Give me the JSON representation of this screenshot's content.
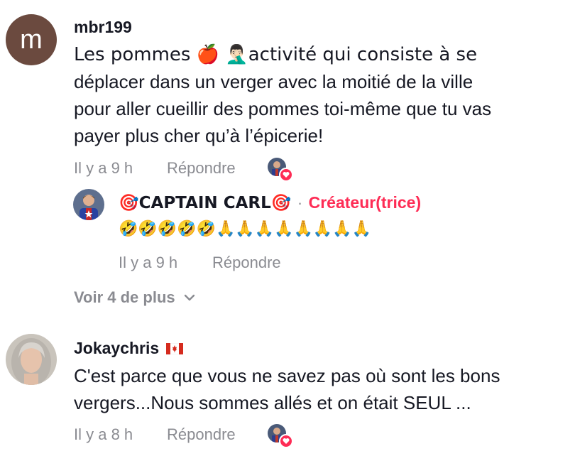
{
  "comments": [
    {
      "avatar_letter": "m",
      "username": "mbr199",
      "text_line1": "Les pommes 🍎 🤦🏻‍♂️activité qui consiste à se",
      "text_line2": "déplacer dans un verger avec la moitié de la ville",
      "text_line3": "pour aller cueillir des pommes toi-même que tu vas",
      "text_line4": "payer plus cher qu’à l’épicerie!",
      "time": "Il y a 9 h",
      "reply_label": "Répondre"
    },
    {
      "username": "Jokaychris",
      "flag": "🇨🇦",
      "text_line1": "C'est parce que vous ne savez pas où sont les bons",
      "text_line2": "vergers...Nous sommes allés et on était SEUL ...",
      "time": "Il y a 8 h",
      "reply_label": "Répondre"
    }
  ],
  "reply": {
    "username": "🎯CAPTAIN CARL🎯",
    "separator": "·",
    "creator_label": "Créateur(trice)",
    "text": "🤣🤣🤣🤣🤣🙏🙏🙏🙏🙏🙏🙏🙏",
    "time": "Il y a 9 h",
    "reply_label": "Répondre"
  },
  "view_more": {
    "label": "Voir 4 de plus",
    "icon": "chevron-down-icon"
  },
  "colors": {
    "creator": "#fe2c55",
    "meta": "#8a8b91",
    "text": "#161823",
    "avatar_m": "#6b4a3f"
  }
}
